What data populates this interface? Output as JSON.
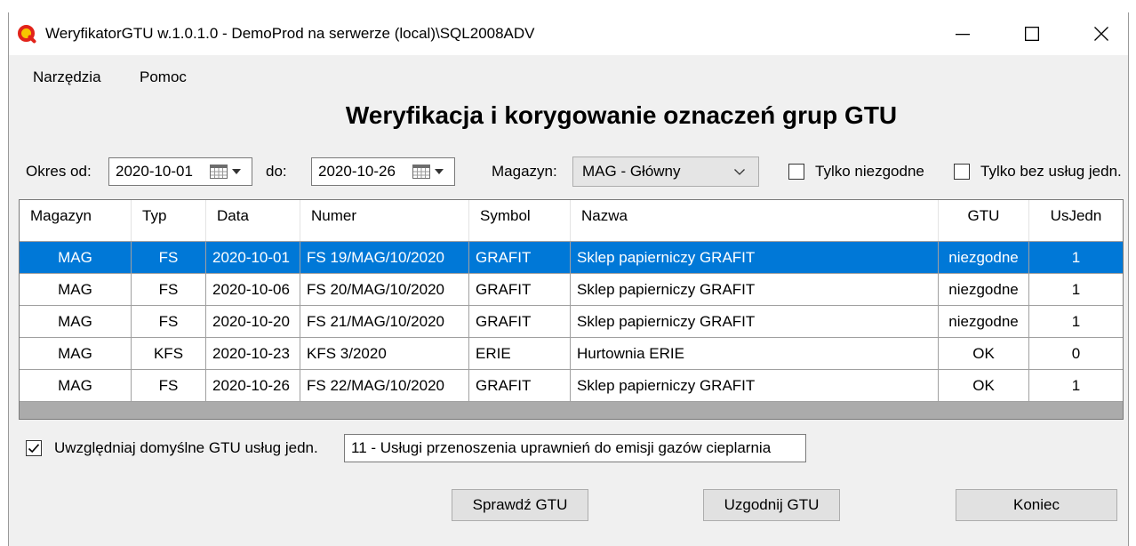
{
  "window": {
    "title": "WeryfikatorGTU w.1.0.1.0 - DemoProd na serwerze (local)\\SQL2008ADV"
  },
  "icons": {
    "app": "app-logo-icon",
    "minimize": "minimize-icon",
    "maximize": "maximize-icon",
    "close": "close-icon",
    "date_picker": "calendar-icon",
    "date_picker_arrow": "dropdown-arrow-icon",
    "select": "chevron-down-icon",
    "checked": "checkmark-icon"
  },
  "menu": {
    "items": [
      "Narzędzia",
      "Pomoc"
    ]
  },
  "heading": "Weryfikacja i korygowanie oznaczeń grup GTU",
  "filters": {
    "period_from": {
      "label": "Okres od:",
      "value": "2020-10-01"
    },
    "period_to": {
      "label": "do:",
      "value": "2020-10-26"
    },
    "warehouse": {
      "label": "Magazyn:",
      "value": "MAG - Główny"
    },
    "only_mismatched": {
      "label": "Tylko niezgodne",
      "checked": false
    },
    "only_without_services": {
      "label": "Tylko bez usług jedn.",
      "checked": false
    }
  },
  "grid": {
    "columns": [
      "Magazyn",
      "Typ",
      "Data",
      "Numer",
      "Symbol",
      "Nazwa",
      "GTU",
      "UsJedn"
    ],
    "rows": [
      [
        "MAG",
        "FS",
        "2020-10-01",
        "FS 19/MAG/10/2020",
        "GRAFIT",
        "Sklep papierniczy GRAFIT",
        "niezgodne",
        "1"
      ],
      [
        "MAG",
        "FS",
        "2020-10-06",
        "FS 20/MAG/10/2020",
        "GRAFIT",
        "Sklep papierniczy GRAFIT",
        "niezgodne",
        "1"
      ],
      [
        "MAG",
        "FS",
        "2020-10-20",
        "FS 21/MAG/10/2020",
        "GRAFIT",
        "Sklep papierniczy GRAFIT",
        "niezgodne",
        "1"
      ],
      [
        "MAG",
        "KFS",
        "2020-10-23",
        "KFS 3/2020",
        "ERIE",
        "Hurtownia ERIE",
        "OK",
        "0"
      ],
      [
        "MAG",
        "FS",
        "2020-10-26",
        "FS 22/MAG/10/2020",
        "GRAFIT",
        "Sklep papierniczy GRAFIT",
        "OK",
        "1"
      ]
    ],
    "selected_row": 0
  },
  "options": {
    "include_default_gtu": {
      "label": "Uwzględniaj domyślne GTU usług jedn.",
      "checked": true
    },
    "default_gtu": "11 - Usługi przenoszenia uprawnień do emisji gazów cieplarnia"
  },
  "buttons": {
    "check": "Sprawdź GTU",
    "reconcile": "Uzgodnij GTU",
    "exit": "Koniec"
  },
  "colors": {
    "selection": "#0078D7",
    "selection_text": "#FFFFFF",
    "window_background": "#F0F0F0",
    "grid_background": "#ABABAB",
    "button_face": "#E1E1E1"
  }
}
